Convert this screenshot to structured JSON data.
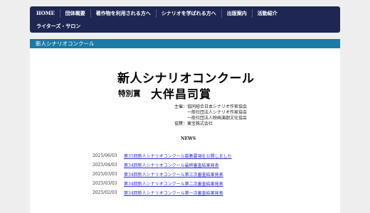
{
  "nav": {
    "row1": [
      "HOME",
      "団体概要",
      "著作物を利用される方へ",
      "シナリオを学ばれる方へ",
      "出版案内",
      "活動紹介"
    ],
    "row2": [
      "ライターズ・サロン"
    ]
  },
  "section": {
    "title": "新人シナリオコンクール"
  },
  "heading": {
    "main": "新人シナリオコンクール",
    "prize_prefix": "特別賞",
    "prize_name": "大伴昌司賞"
  },
  "organizers": {
    "host_label": "主催：",
    "hosts": [
      "協同組合日本シナリオ作家協会",
      "一般社団法人シナリオ作家協会",
      "一般社団法人映画演劇文化協会"
    ],
    "sponsor_label": "協賛：",
    "sponsor": "東宝株式会社"
  },
  "news": {
    "heading": "NEWS",
    "items": [
      {
        "date": "2025/06/03",
        "title": "第35回新人シナリオコンクール募集要項を公開しました"
      },
      {
        "date": "2025/04/03",
        "title": "第34回新人シナリオコンクール最終審査結果発表"
      },
      {
        "date": "2025/03/03",
        "title": "第34回新人シナリオコンクール第三次審査結果発表"
      },
      {
        "date": "2025/03/03",
        "title": "第34回新人シナリオコンクール第二次審査結果発表"
      },
      {
        "date": "2025/02/03",
        "title": "第34回新人シナリオコンクール第一次審査結果発表"
      }
    ]
  }
}
